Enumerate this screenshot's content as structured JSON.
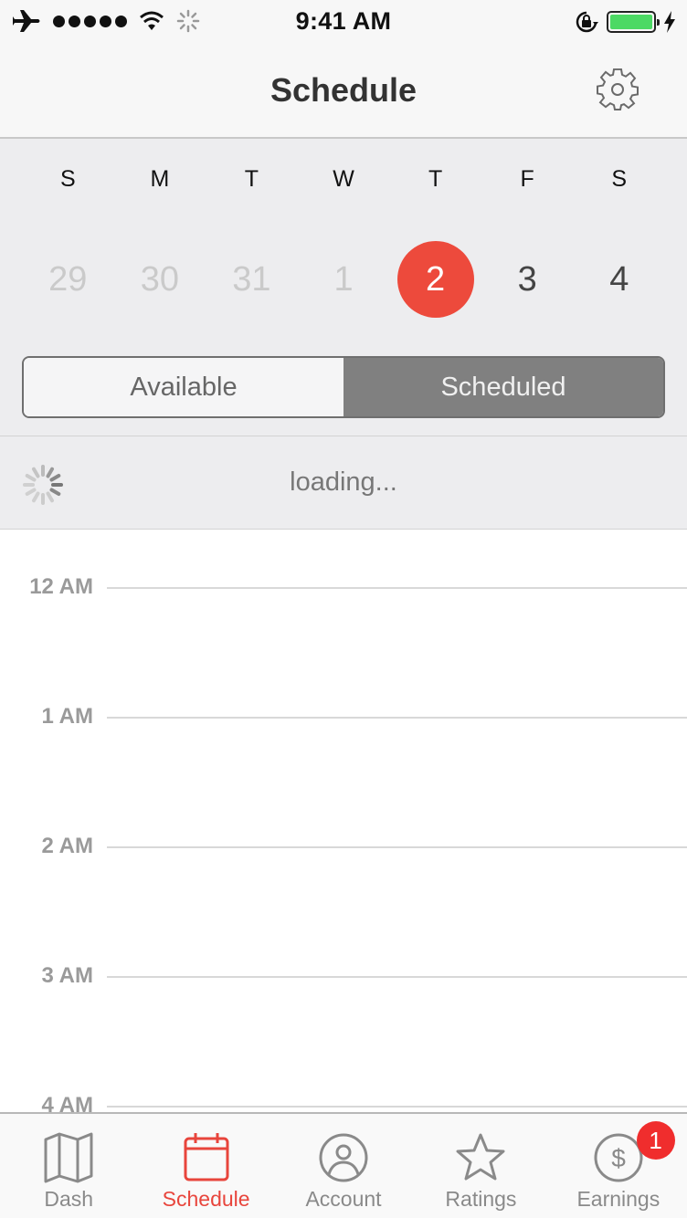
{
  "status_bar": {
    "time": "9:41 AM",
    "icons": [
      "airplane-icon",
      "signal-dots-icon",
      "wifi-icon",
      "activity-spinner-icon",
      "orientation-lock-icon",
      "battery-icon",
      "charging-bolt-icon"
    ],
    "battery_level": 1.0,
    "battery_color": "#4cd964"
  },
  "nav": {
    "title": "Schedule",
    "settings_icon": "gear-icon"
  },
  "week": {
    "days_of_week": [
      "S",
      "M",
      "T",
      "W",
      "T",
      "F",
      "S"
    ],
    "dates": [
      {
        "label": "29",
        "state": "past"
      },
      {
        "label": "30",
        "state": "past"
      },
      {
        "label": "31",
        "state": "past"
      },
      {
        "label": "1",
        "state": "past"
      },
      {
        "label": "2",
        "state": "selected"
      },
      {
        "label": "3",
        "state": "future"
      },
      {
        "label": "4",
        "state": "future"
      }
    ],
    "selected_color": "#ed4a3c"
  },
  "segmented": {
    "options": [
      "Available",
      "Scheduled"
    ],
    "selected": "Scheduled"
  },
  "loading": {
    "text": "loading..."
  },
  "timeline": {
    "hours": [
      "12 AM",
      "1 AM",
      "2 AM",
      "3 AM",
      "4 AM"
    ]
  },
  "tab_bar": {
    "active_color": "#e8453c",
    "tabs": [
      {
        "label": "Dash",
        "icon": "map-icon",
        "active": false
      },
      {
        "label": "Schedule",
        "icon": "calendar-icon",
        "active": true
      },
      {
        "label": "Account",
        "icon": "user-circle-icon",
        "active": false
      },
      {
        "label": "Ratings",
        "icon": "star-icon",
        "active": false
      },
      {
        "label": "Earnings",
        "icon": "dollar-circle-icon",
        "active": false,
        "badge": "1"
      }
    ]
  }
}
